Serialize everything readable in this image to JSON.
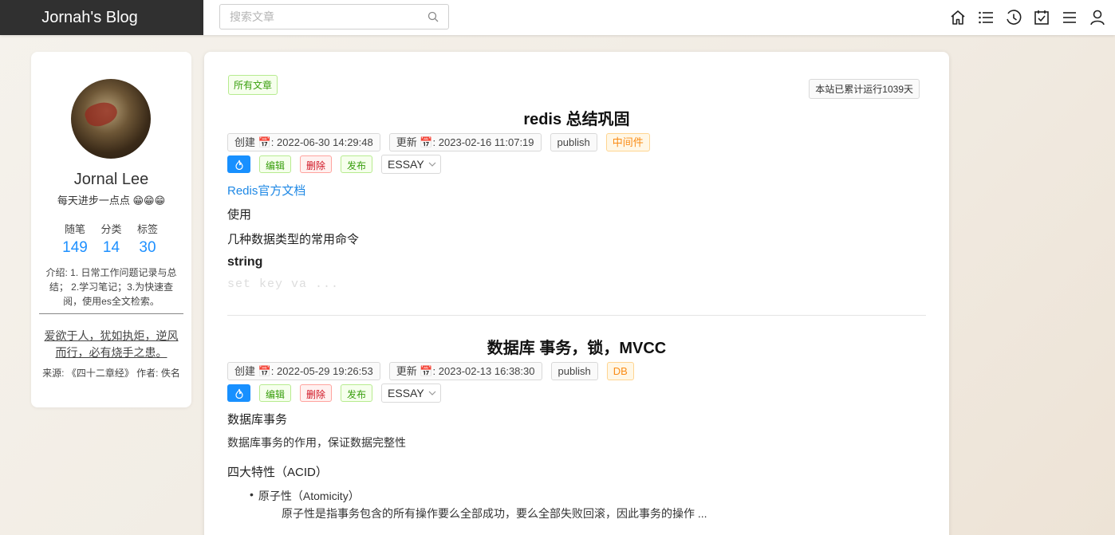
{
  "brand": "Jornah's Blog",
  "search": {
    "placeholder": "搜索文章"
  },
  "nav_icons": [
    "home-icon",
    "list-icon",
    "history-icon",
    "calendar-check-icon",
    "menu-icon",
    "user-icon"
  ],
  "profile": {
    "name": "Jornal Lee",
    "motto": "每天进步一点点 😁😁😁",
    "stats": [
      {
        "label": "随笔",
        "value": "149"
      },
      {
        "label": "分类",
        "value": "14"
      },
      {
        "label": "标签",
        "value": "30"
      }
    ],
    "intro": "介绍: 1. 日常工作问题记录与总结； 2.学习笔记；3.为快速查阅，使用es全文检索。",
    "quote": "爱欲于人，犹如执炬，逆风而行，必有烧手之患。",
    "source": "来源: 《四十二章经》 作者: 佚名"
  },
  "main": {
    "all_tag": "所有文章",
    "runtime": "本站已累计运行1039天",
    "posts": [
      {
        "title": "redis 总结巩固",
        "created": "创建 📅: 2022-06-30 14:29:48",
        "updated": "更新 📅: 2023-02-16 11:07:19",
        "status": "publish",
        "category": "中间件",
        "edit": "编辑",
        "delete": "删除",
        "publish": "发布",
        "type": "ESSAY",
        "lines": [
          "Redis官方文档",
          "使用",
          "几种数据类型的常用命令",
          "string",
          "set key va ..."
        ]
      },
      {
        "title": "数据库 事务，锁，MVCC",
        "created": "创建 📅: 2022-05-29 19:26:53",
        "updated": "更新 📅: 2023-02-13 16:38:30",
        "status": "publish",
        "category": "DB",
        "edit": "编辑",
        "delete": "删除",
        "publish": "发布",
        "type": "ESSAY",
        "lines": [
          "数据库事务",
          "数据库事务的作用，保证数据完整性",
          "四大特性（ACID）",
          "原子性（Atomicity）",
          "原子性是指事务包含的所有操作要么全部成功，要么全部失败回滚，因此事务的操作 ..."
        ]
      }
    ]
  }
}
